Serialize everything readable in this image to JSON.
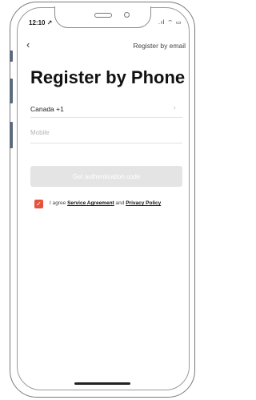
{
  "status_bar": {
    "time": "12:10 ↗",
    "indicators": ".ıl ⌔ ▭"
  },
  "nav": {
    "back_icon": "chevron-left-icon",
    "back_glyph": "‹",
    "register_by_email": "Register by email"
  },
  "title": "Register by Phone",
  "country": {
    "value": "Canada +1",
    "chevron_glyph": "›"
  },
  "mobile": {
    "placeholder": "Mobile",
    "value": ""
  },
  "auth_button": {
    "label": "Get authentication code",
    "enabled": false,
    "color": "#e4e4e4"
  },
  "agreement": {
    "checked": true,
    "check_glyph": "✓",
    "checkbox_color": "#e5533d",
    "prefix": "I agree",
    "service_link": "Service Agreement",
    "conjunction": "and",
    "privacy_link": "Privacy Policy"
  }
}
